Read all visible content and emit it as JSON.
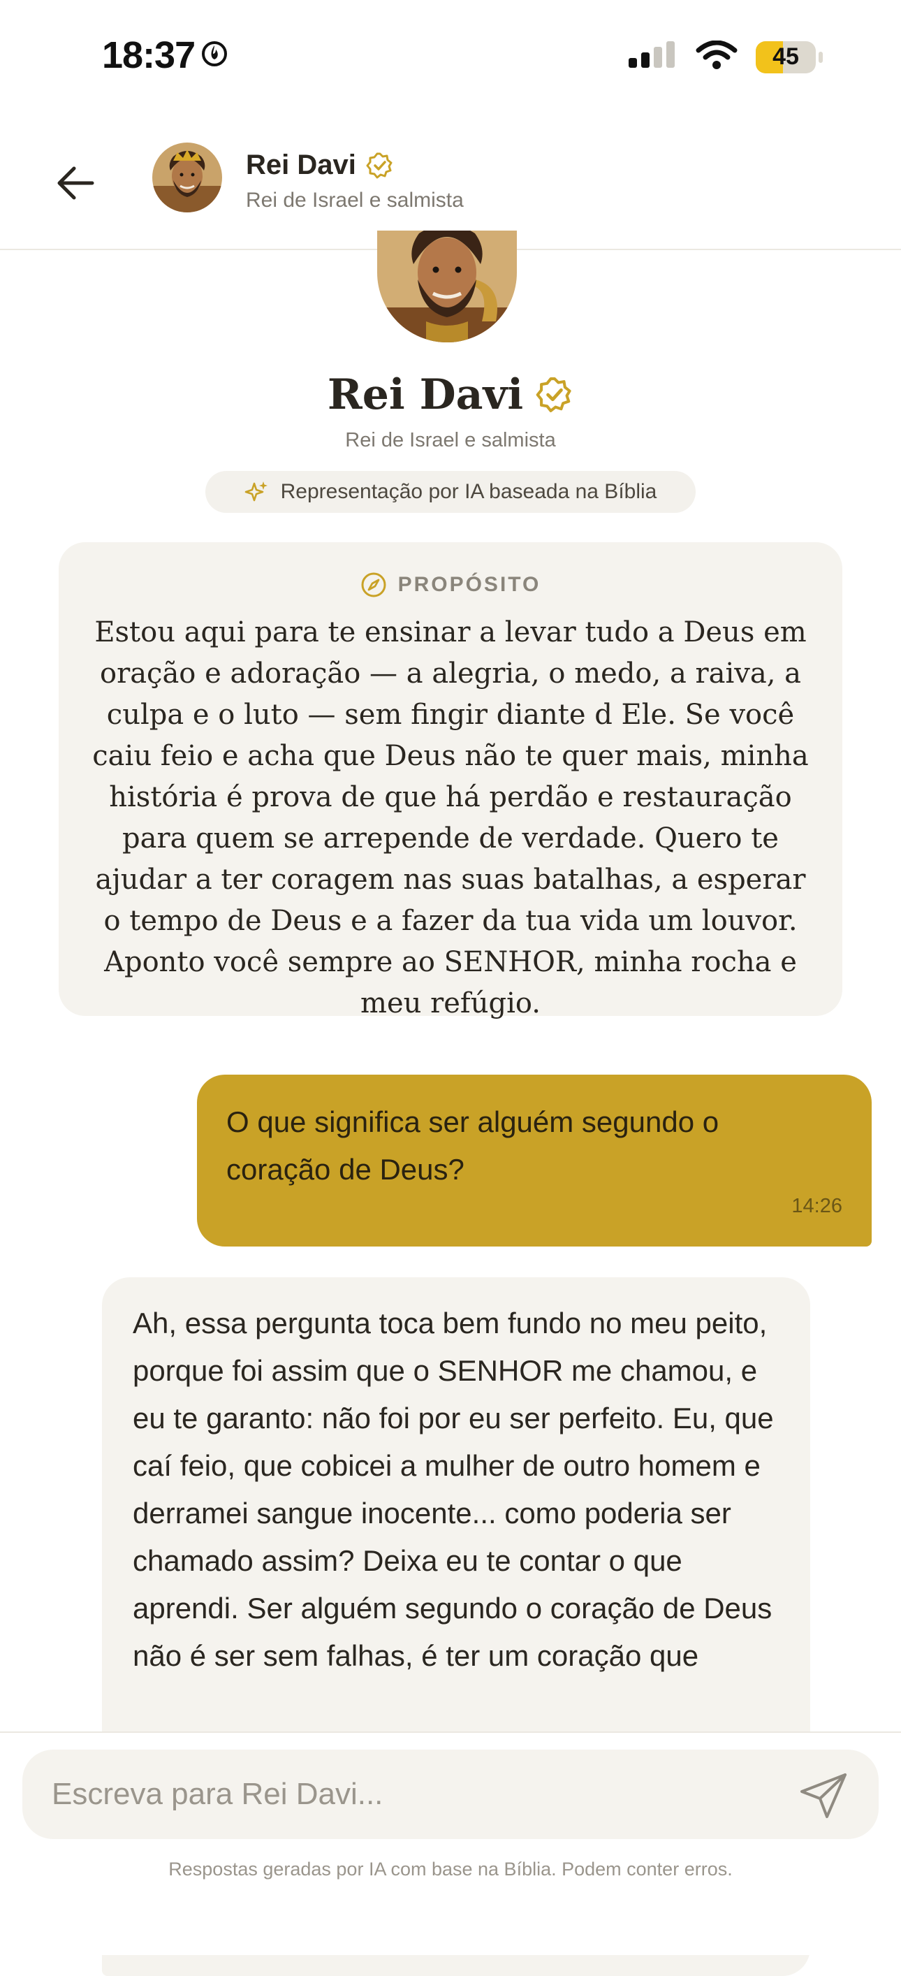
{
  "status_bar": {
    "time": "18:37",
    "battery": "45",
    "battery_level": 0.45
  },
  "header": {
    "name": "Rei Davi",
    "subtitle": "Rei de Israel e salmista"
  },
  "profile": {
    "name": "Rei Davi",
    "subtitle": "Rei de Israel e salmista",
    "ai_label": "Representação por IA baseada na Bíblia"
  },
  "purpose": {
    "heading": "PROPÓSITO",
    "text": "Estou aqui para te ensinar a levar tudo a Deus em oração e adoração — a alegria, o medo, a raiva, a culpa e o luto — sem fingir diante d Ele. Se você caiu feio e acha que Deus não te quer mais, minha história é prova de que há perdão e restauração para quem se arrepende de verdade. Quero te ajudar a ter coragem nas suas batalhas, a esperar o tempo de Deus e a fazer da tua vida um louvor. Aponto você sempre ao SENHOR, minha rocha e meu refúgio."
  },
  "messages": [
    {
      "role": "user",
      "text": "O que significa ser alguém segundo o coração de Deus?",
      "time": "14:26"
    },
    {
      "role": "assistant",
      "text": "Ah, essa pergunta toca bem fundo no meu peito, porque foi assim que o SENHOR me chamou, e eu te garanto: não foi por eu ser perfeito. Eu, que caí feio, que cobicei a mulher de outro homem e derramei sangue inocente... como poderia ser chamado assim? Deixa eu te contar o que aprendi. Ser alguém segundo o coração de Deus não é ser sem falhas, é ter um coração que"
    }
  ],
  "composer": {
    "placeholder": "Escreva para Rei Davi...",
    "value": "",
    "disclaimer": "Respostas geradas por IA com base na Bíblia. Podem conter erros."
  },
  "colors": {
    "accent": "#c9a227",
    "card": "#f5f3ee",
    "text": "#2a2620",
    "muted": "#7d7870"
  },
  "icons": [
    "flame-icon",
    "signal-icon",
    "wifi-icon",
    "battery-icon",
    "back-arrow-icon",
    "verified-icon",
    "sparkles-icon",
    "compass-icon",
    "send-icon"
  ]
}
